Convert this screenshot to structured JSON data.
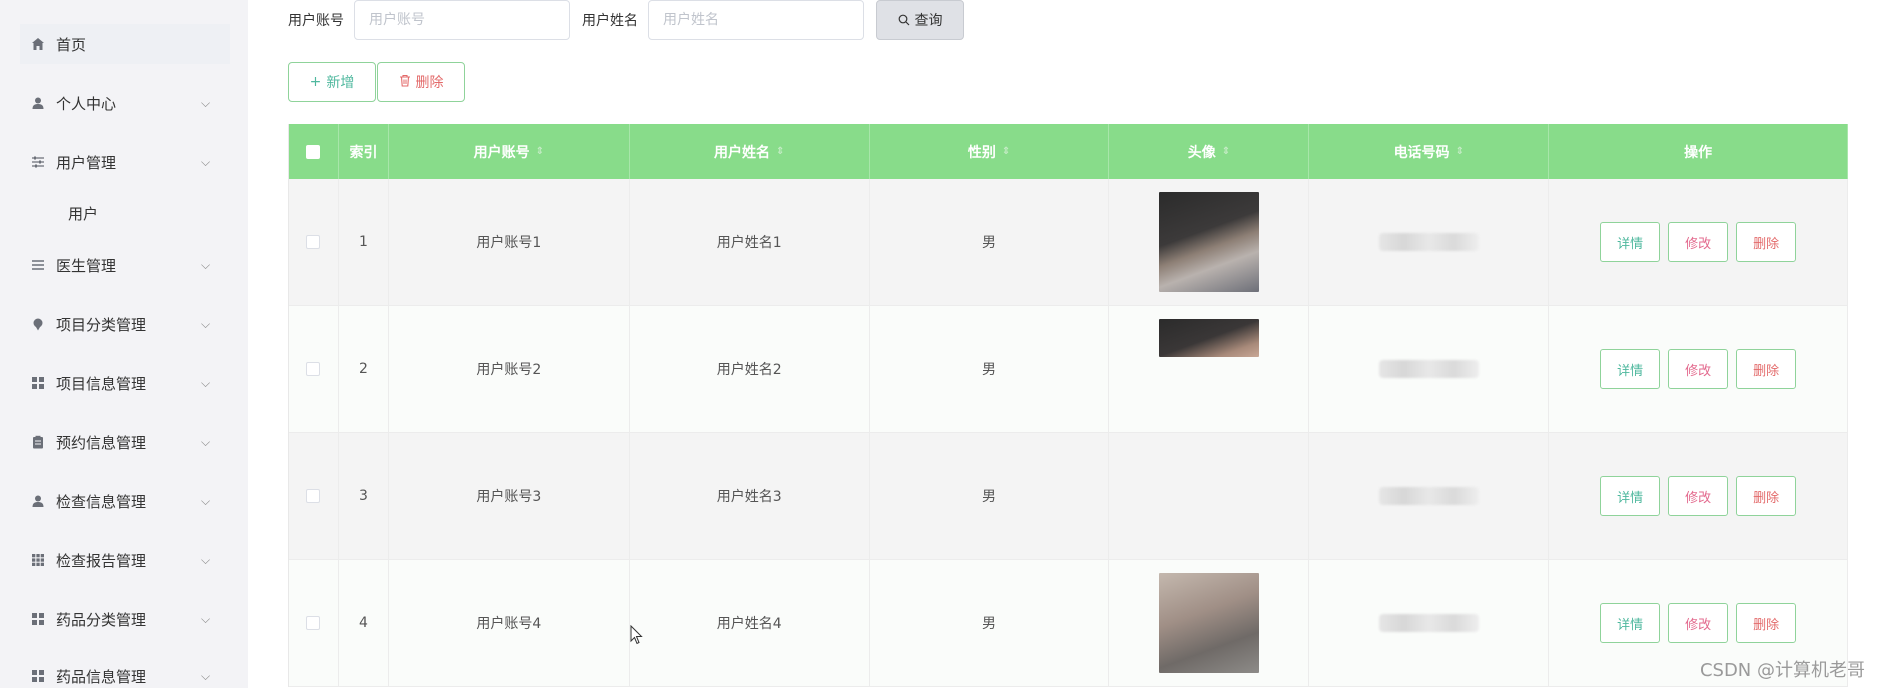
{
  "sidebar": {
    "home": "首页",
    "items": [
      {
        "label": "个人中心",
        "icon": "user-icon"
      },
      {
        "label": "用户管理",
        "icon": "sliders-icon"
      },
      {
        "label": "医生管理",
        "icon": "list-icon"
      },
      {
        "label": "项目分类管理",
        "icon": "pin-icon"
      },
      {
        "label": "项目信息管理",
        "icon": "grid-icon"
      },
      {
        "label": "预约信息管理",
        "icon": "clipboard-icon"
      },
      {
        "label": "检查信息管理",
        "icon": "user-icon"
      },
      {
        "label": "检查报告管理",
        "icon": "grid-icon"
      },
      {
        "label": "药品分类管理",
        "icon": "grid-icon"
      },
      {
        "label": "药品信息管理",
        "icon": "grid-icon"
      }
    ],
    "sub_user": "用户"
  },
  "search": {
    "account_label": "用户账号",
    "account_placeholder": "用户账号",
    "name_label": "用户姓名",
    "name_placeholder": "用户姓名",
    "query_button": "查询"
  },
  "actions": {
    "add_label": "新增",
    "delete_label": "删除"
  },
  "table": {
    "headers": {
      "index": "索引",
      "account": "用户账号",
      "name": "用户姓名",
      "gender": "性别",
      "avatar": "头像",
      "phone": "电话号码",
      "ops": "操作"
    },
    "rows": [
      {
        "index": "1",
        "account": "用户账号1",
        "name": "用户姓名1",
        "gender": "男"
      },
      {
        "index": "2",
        "account": "用户账号2",
        "name": "用户姓名2",
        "gender": "男"
      },
      {
        "index": "3",
        "account": "用户账号3",
        "name": "用户姓名3",
        "gender": "男"
      },
      {
        "index": "4",
        "account": "用户账号4",
        "name": "用户姓名4",
        "gender": "男"
      }
    ],
    "op_labels": {
      "detail": "详情",
      "edit": "修改",
      "delete": "删除"
    }
  },
  "watermark": "CSDN @计算机老哥",
  "colors": {
    "header": "#88dc8a",
    "accent": "#4fb89e",
    "danger": "#e36a6a"
  }
}
